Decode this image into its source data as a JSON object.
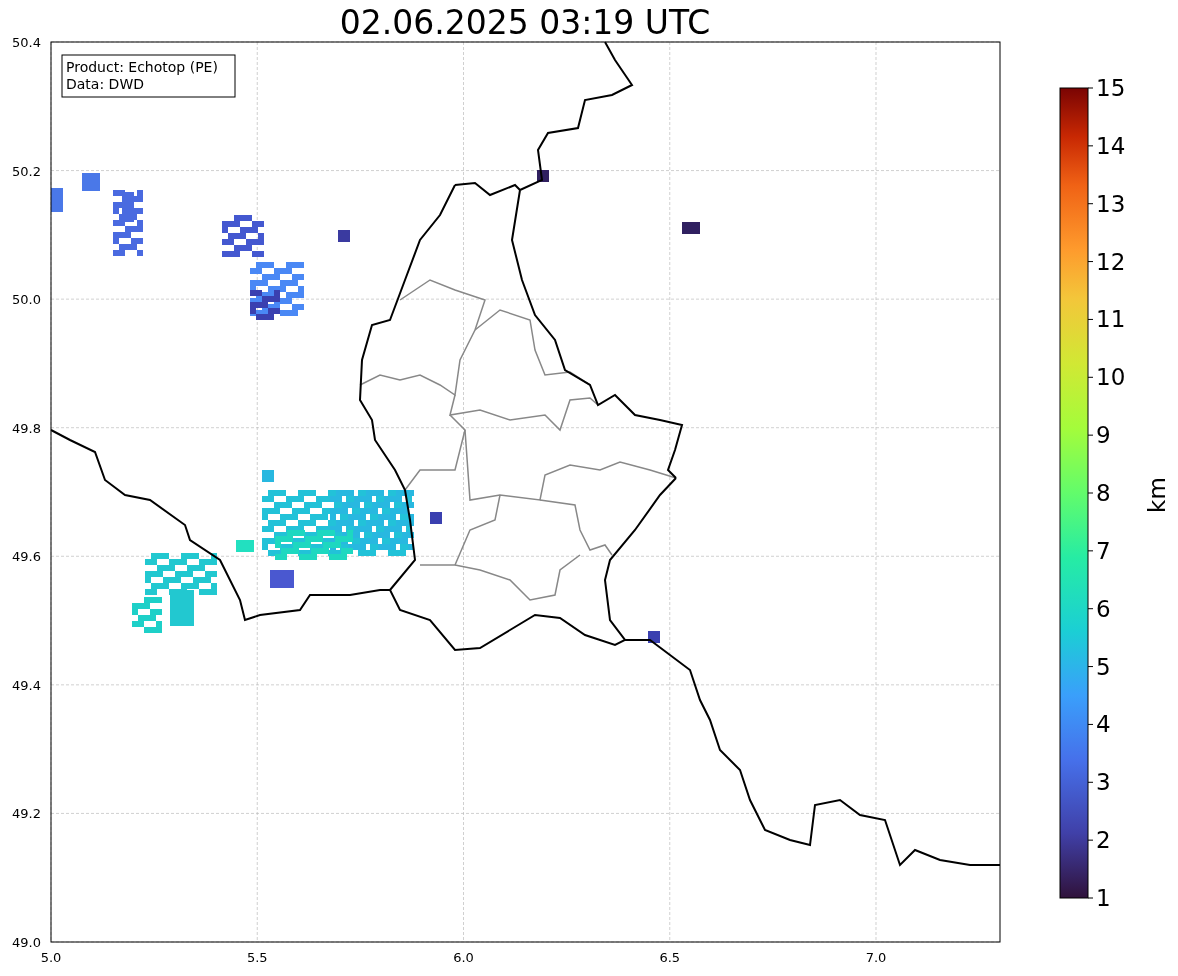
{
  "title": "02.06.2025 03:19 UTC",
  "legend": [
    "Product: Echotop (PE)",
    "Data: DWD"
  ],
  "map": {
    "x_ticks": [
      "5.0",
      "5.5",
      "6.0",
      "6.5",
      "7.0"
    ],
    "y_ticks": [
      "50.4",
      "50.2",
      "50.0",
      "49.8",
      "49.6",
      "49.4",
      "49.2",
      "49.0"
    ]
  },
  "colorbar": {
    "label": "km",
    "ticks": [
      "15",
      "14",
      "13",
      "12",
      "11",
      "10",
      "9",
      "8",
      "7",
      "6",
      "5",
      "4",
      "3",
      "2",
      "1"
    ]
  }
}
